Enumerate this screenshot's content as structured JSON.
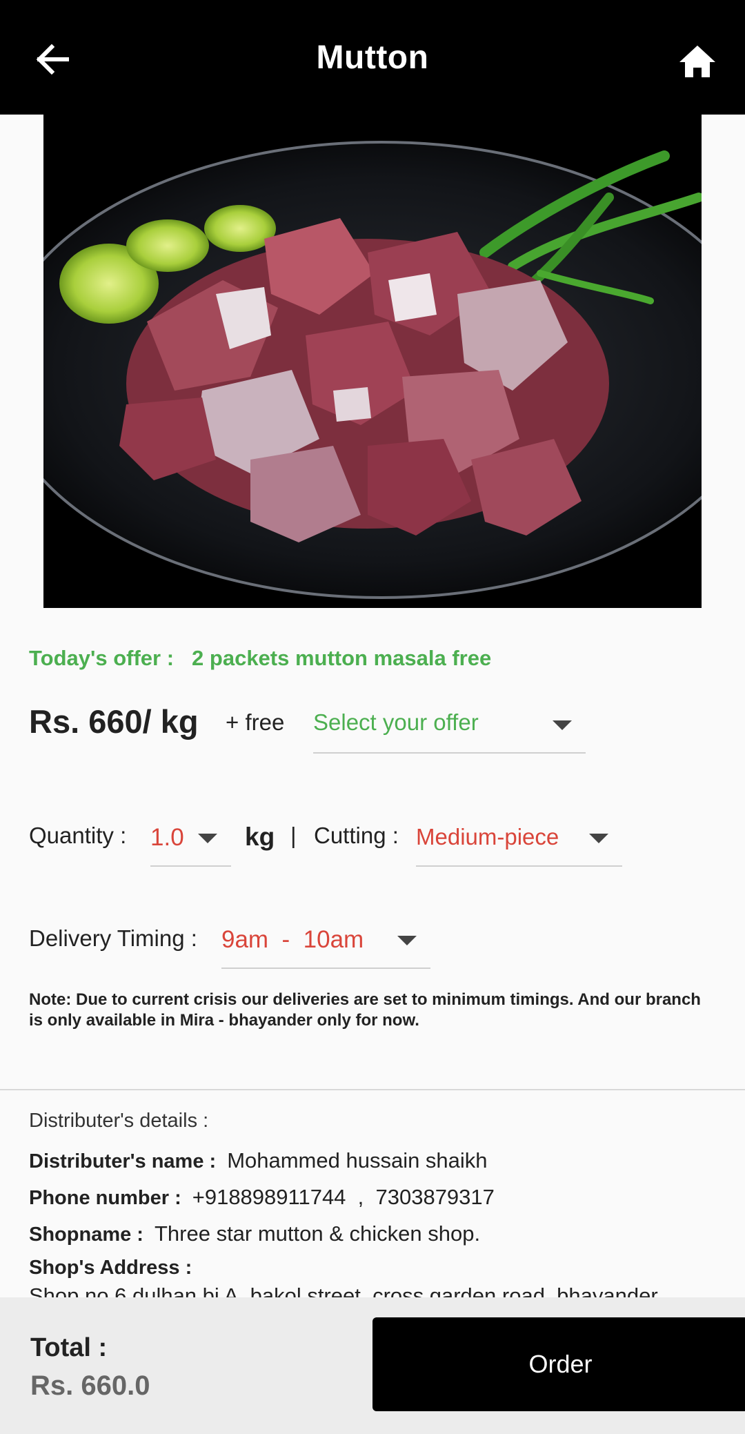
{
  "app_bar": {
    "title": "Mutton",
    "back_icon": "arrow-left-icon",
    "home_icon": "home-icon"
  },
  "product": {
    "image_description": "",
    "offer_label": "Today's offer :",
    "offer_text": "2 packets mutton masala free",
    "price": "Rs. 660/ kg",
    "plus_free": "+ free",
    "offer_select_value": "Select your offer"
  },
  "order_options": {
    "quantity_label": "Quantity :",
    "quantity_value": "1.0",
    "unit": "kg",
    "separator": "|",
    "cutting_label": "Cutting :",
    "cutting_value": "Medium-piece",
    "delivery_label": "Delivery Timing :",
    "delivery_value": "9am  -  10am"
  },
  "note": "Note: Due to current crisis our deliveries are set to minimum timings. And our branch is only available in Mira - bhayander only for now.",
  "distributor": {
    "heading": "Distributer's details :",
    "name_label": "Distributer's name :",
    "name_value": "Mohammed hussain shaikh",
    "phone_label": "Phone number :",
    "phone_value": "+918898911744  ,  7303879317",
    "shop_label": "Shopname :",
    "shop_value": "Three star mutton & chicken shop.",
    "address_label": "Shop's Address :",
    "address_value": "Shop no 6 dulhan bi A, bakol street, cross garden road, bhayander"
  },
  "footer": {
    "total_label": "Total :",
    "total_value": "Rs. 660.0",
    "order_label": "Order"
  },
  "colors": {
    "accent_green": "#4caf50",
    "accent_red": "#d9453a",
    "bar_black": "#000000"
  }
}
